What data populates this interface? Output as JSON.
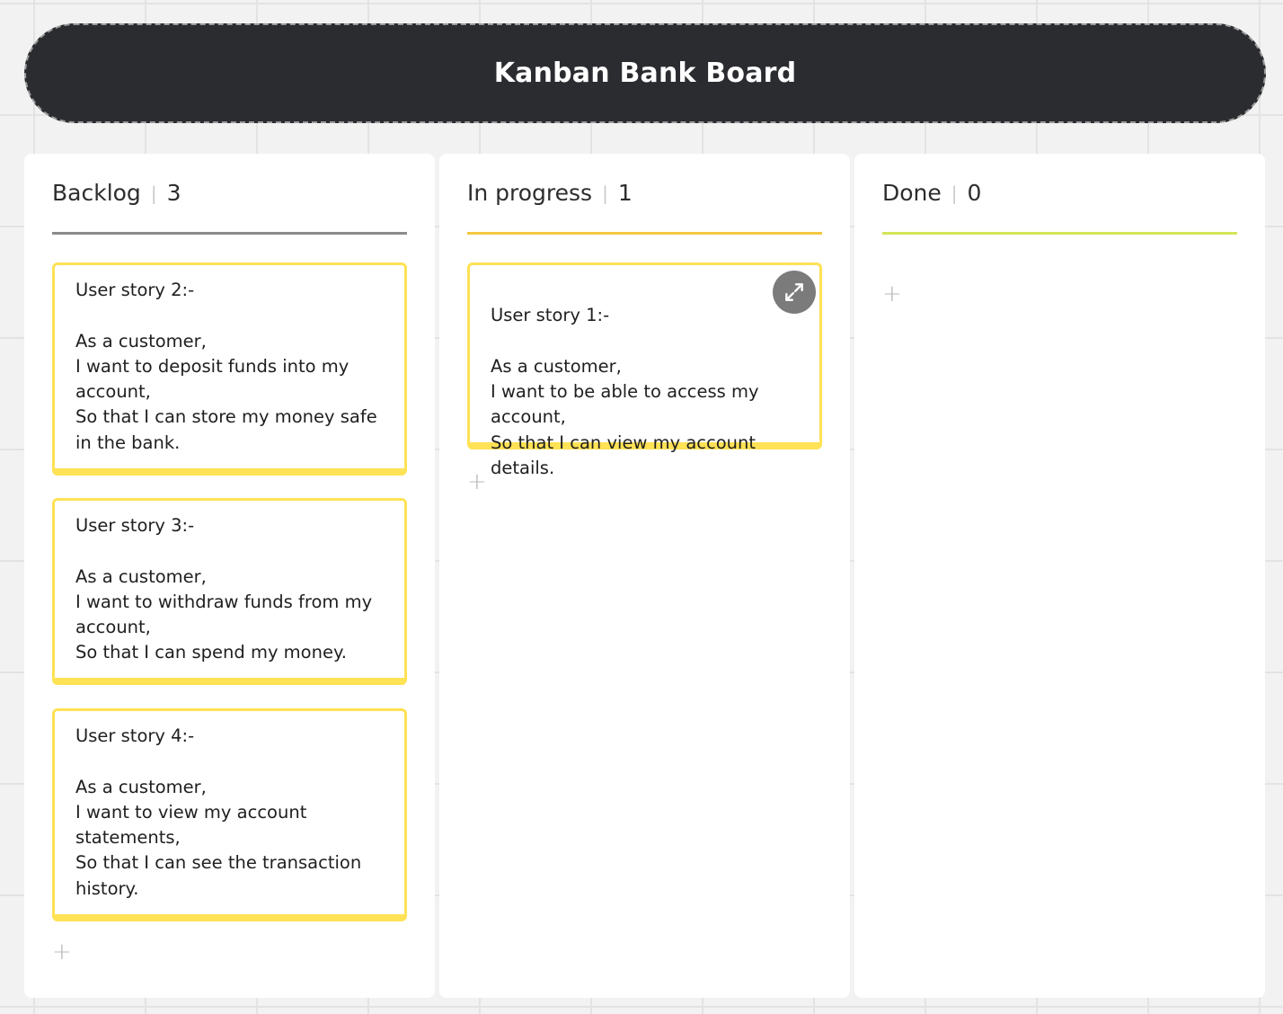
{
  "board": {
    "title": "Kanban Bank Board"
  },
  "columns": [
    {
      "name": "Backlog",
      "count": "3",
      "accent": "#8a8a8a",
      "cards": [
        {
          "text": "User story 2:-\n\nAs a customer,\nI want to deposit funds into my account,\nSo that I can store my money safe in the bank."
        },
        {
          "text": "User story 3:-\n\nAs a customer,\nI want to withdraw funds from my account,\nSo that I can spend my money."
        },
        {
          "text": "User story 4:-\n\nAs a customer,\nI want to view my account statements,\nSo that I can see the transaction history."
        }
      ],
      "add_label": "+"
    },
    {
      "name": "In progress",
      "count": "1",
      "accent": "#f5c842",
      "cards": [
        {
          "text": "User story 1:-\n\nAs a customer,\nI want to be able to access my account,\nSo that I can view my account details."
        }
      ],
      "add_label": "+"
    },
    {
      "name": "Done",
      "count": "0",
      "accent": "#d4e558",
      "cards": [],
      "add_label": "+"
    }
  ],
  "colors": {
    "title_bar": "#2b2c30",
    "card_border": "#ffe255",
    "canvas": "#f2f2f2"
  },
  "icons": {
    "expand": "expand-arrows-icon",
    "add": "plus-icon"
  }
}
